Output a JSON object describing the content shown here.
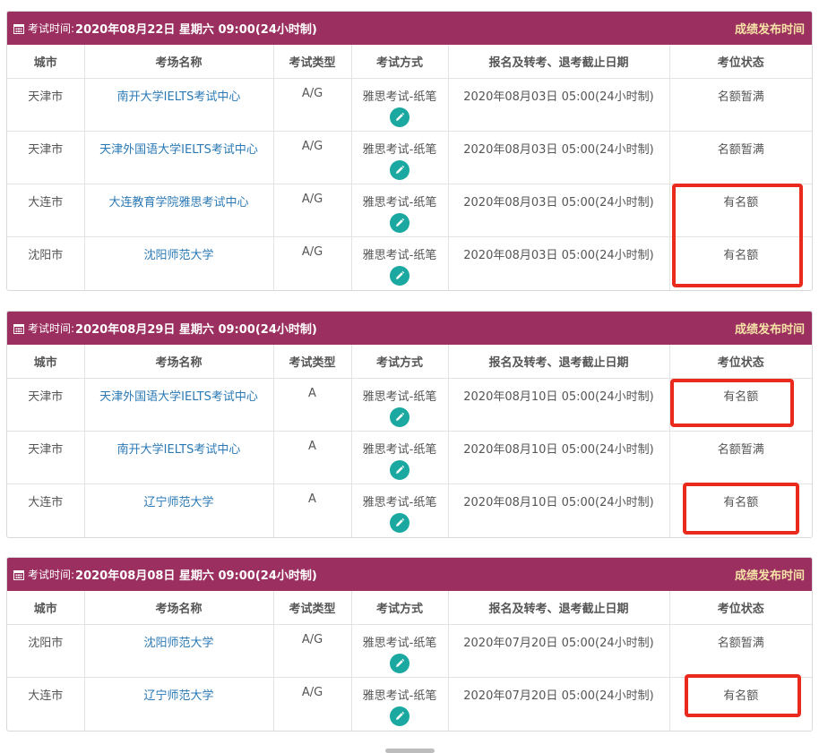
{
  "header_prefix": "考试时间: ",
  "header_right": "成绩发布时间",
  "columns": [
    "城市",
    "考场名称",
    "考试类型",
    "考试方式",
    "报名及转考、退考截止日期",
    "考位状态"
  ],
  "panels": [
    {
      "date": "2020年08月22日 星期六 09:00(24小时制)",
      "rows": [
        {
          "city": "天津市",
          "venue": "南开大学IELTS考试中心",
          "type": "A/G",
          "mode": "雅思考试-纸笔",
          "deadline": "2020年08月03日 05:00(24小时制)",
          "status": "名额暂满"
        },
        {
          "city": "天津市",
          "venue": "天津外国语大学IELTS考试中心",
          "type": "A/G",
          "mode": "雅思考试-纸笔",
          "deadline": "2020年08月03日 05:00(24小时制)",
          "status": "名额暂满"
        },
        {
          "city": "大连市",
          "venue": "大连教育学院雅思考试中心",
          "type": "A/G",
          "mode": "雅思考试-纸笔",
          "deadline": "2020年08月03日 05:00(24小时制)",
          "status": "有名额"
        },
        {
          "city": "沈阳市",
          "venue": "沈阳师范大学",
          "type": "A/G",
          "mode": "雅思考试-纸笔",
          "deadline": "2020年08月03日 05:00(24小时制)",
          "status": "有名额"
        }
      ]
    },
    {
      "date": "2020年08月29日 星期六 09:00(24小时制)",
      "rows": [
        {
          "city": "天津市",
          "venue": "天津外国语大学IELTS考试中心",
          "type": "A",
          "mode": "雅思考试-纸笔",
          "deadline": "2020年08月10日 05:00(24小时制)",
          "status": "有名额"
        },
        {
          "city": "天津市",
          "venue": "南开大学IELTS考试中心",
          "type": "A",
          "mode": "雅思考试-纸笔",
          "deadline": "2020年08月10日 05:00(24小时制)",
          "status": "名额暂满"
        },
        {
          "city": "大连市",
          "venue": "辽宁师范大学",
          "type": "A",
          "mode": "雅思考试-纸笔",
          "deadline": "2020年08月10日 05:00(24小时制)",
          "status": "有名额"
        }
      ]
    },
    {
      "date": "2020年08月08日 星期六 09:00(24小时制)",
      "rows": [
        {
          "city": "沈阳市",
          "venue": "沈阳师范大学",
          "type": "A/G",
          "mode": "雅思考试-纸笔",
          "deadline": "2020年07月20日 05:00(24小时制)",
          "status": "名额暂满"
        },
        {
          "city": "大连市",
          "venue": "辽宁师范大学",
          "type": "A/G",
          "mode": "雅思考试-纸笔",
          "deadline": "2020年07月20日 05:00(24小时制)",
          "status": "有名额"
        }
      ]
    }
  ],
  "icons": {
    "header": "calendar-icon",
    "mode": "pencil-icon"
  },
  "colors": {
    "header_bg": "#9b3060",
    "header_right_text": "#f6e2a6",
    "link": "#2a79b4",
    "edit_button": "#1ba8a0",
    "highlight": "#ea2a1c"
  }
}
